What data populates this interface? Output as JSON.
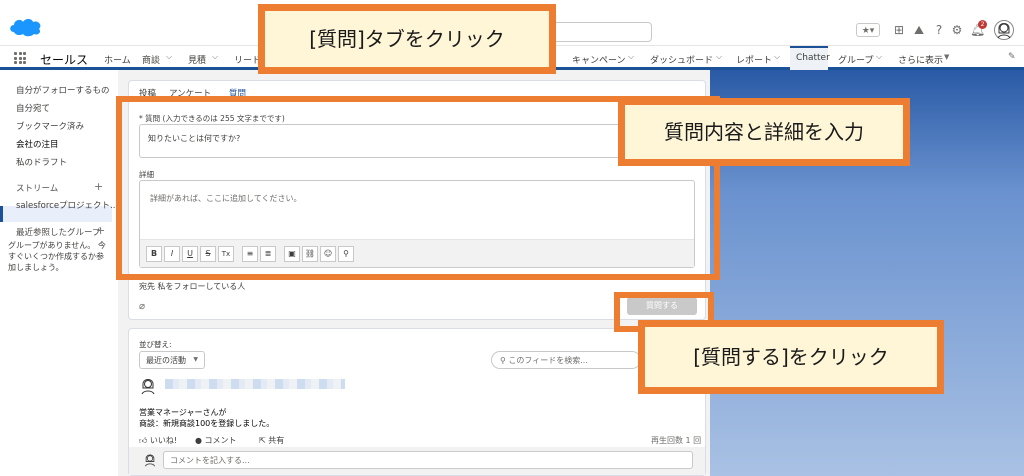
{
  "header": {
    "app_name": "セールス",
    "search_icon": "search-icon",
    "notif_count": "2",
    "colors": {
      "brand": "#1b5297",
      "accent": "#ed7d31",
      "callout_bg": "#fff6d8"
    }
  },
  "nav": {
    "items": [
      {
        "label": "ホーム",
        "chevron": false
      },
      {
        "label": "商談",
        "chevron": true
      },
      {
        "label": "見積",
        "chevron": true
      },
      {
        "label": "リード",
        "chevron": false
      },
      {
        "label": "キャンペーン",
        "chevron": true
      },
      {
        "label": "ダッシュボード",
        "chevron": true
      },
      {
        "label": "レポート",
        "chevron": true
      },
      {
        "label": "Chatter",
        "chevron": false,
        "active": true
      },
      {
        "label": "グループ",
        "chevron": true
      },
      {
        "label": "さらに表示",
        "chevron": true
      }
    ]
  },
  "sidebar": {
    "items": [
      "自分がフォローするもの",
      "自分宛て",
      "ブックマーク済み",
      "会社の注目",
      "私のドラフト"
    ],
    "active": "会社の注目",
    "streams_label": "ストリーム",
    "stream_item": "salesforceプロジェクト...",
    "groups_label": "最近参照したグループ",
    "groups_empty": "グループがありません。 今すぐいくつか作成するか参加しましょう。"
  },
  "publisher": {
    "tabs": [
      "投稿",
      "アンケート",
      "質問"
    ],
    "active_tab": "質問",
    "question_label": "* 質問 (入力できるのは 255 文字までです)",
    "question_value": "知りたいことは何ですか?",
    "detail_label": "詳細",
    "detail_placeholder": "詳細があれば、ここに追加してください。",
    "toolbar": [
      "B",
      "I",
      "U",
      "S",
      "Tx",
      "≡",
      "≣",
      "▣",
      "⛓",
      "☺",
      "⚲"
    ],
    "to_label": "宛先",
    "to_value": "私をフォローしている人",
    "ask_button": "質問する"
  },
  "feed": {
    "sort_label": "並び替え:",
    "sort_value": "最近の活動",
    "search_placeholder": "このフィードを検索...",
    "post_line1": "営業マネージャーさんが",
    "post_line2": "商談：新規商談100を登録しました。",
    "like": "いいね!",
    "comment": "コメント",
    "share": "共有",
    "views": "再生回数 1 回",
    "comment_placeholder": "コメントを記入する..."
  },
  "callouts": {
    "tab": "[質問]タブをクリック",
    "content": "質問内容と詳細を入力",
    "ask": "[質問する]をクリック"
  }
}
